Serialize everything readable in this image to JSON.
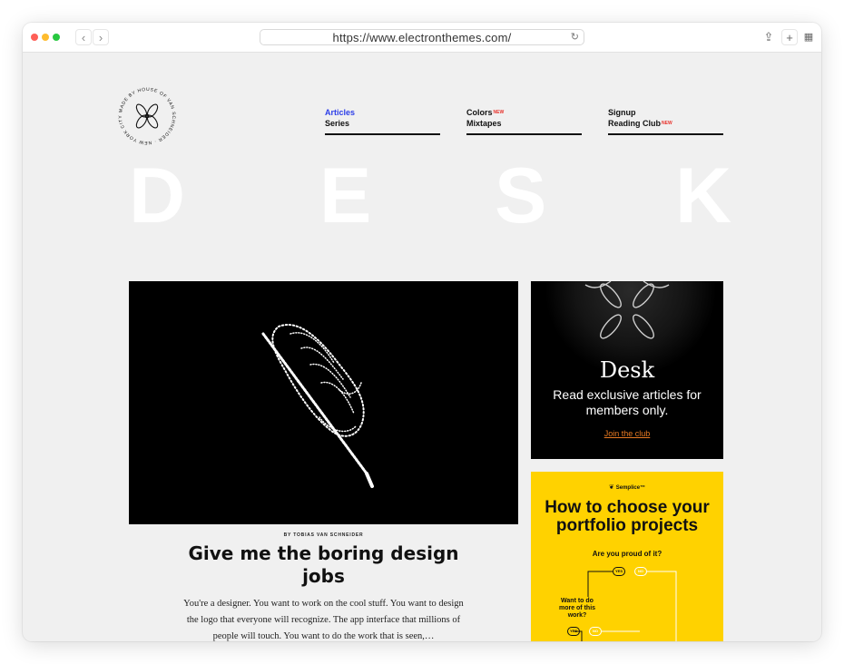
{
  "browser": {
    "url": "https://www.electronthemes.com/"
  },
  "logo": {
    "text": "MADE BY HOUSE OF VAN SCHNEIDER · NEW YORK CITY"
  },
  "nav": {
    "col1": {
      "line1": "Articles",
      "line2": "Series"
    },
    "col2": {
      "line1": "Colors",
      "line1_badge": "NEW",
      "line2": "Mixtapes"
    },
    "col3": {
      "line1": "Signup",
      "line2": "Reading Club",
      "line2_badge": "NEW"
    }
  },
  "masthead": [
    "D",
    "E",
    "S",
    "K"
  ],
  "article": {
    "byline": "BY TOBIAS VAN SCHNEIDER",
    "title": "Give me the boring design jobs",
    "excerpt": "You're a designer. You want to work on the cool stuff. You want to design the logo that everyone will recognize. The app interface that millions of people will touch. You want to do the work that is seen,…"
  },
  "ad_members": {
    "brand": "Desk",
    "tagline": "Read exclusive articles for members only.",
    "cta": "Join the club",
    "cta_color": "#e87a22"
  },
  "ad_semplice": {
    "sponsor": "Semplice",
    "sponsor_mark": "™",
    "title": "How to choose your portfolio projects",
    "question1": "Are you proud of it?",
    "question2": "Want to do more of this work?",
    "yes": "YES",
    "no": "NO",
    "bg_color": "#ffd200"
  },
  "colors": {
    "active_link": "#2c3ee8",
    "new_badge": "#e8312a"
  }
}
